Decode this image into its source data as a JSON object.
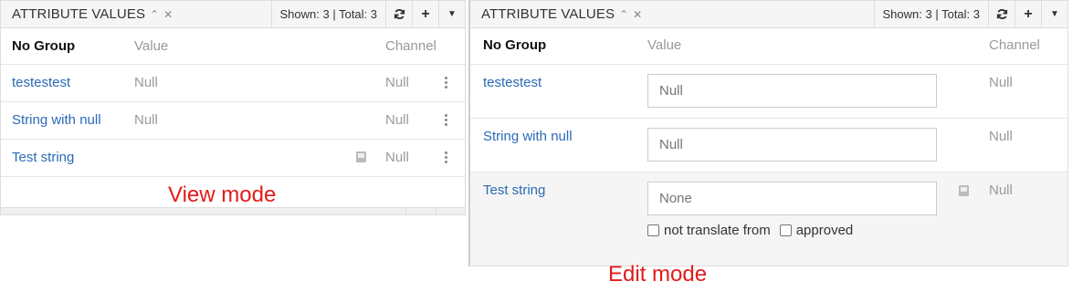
{
  "colors": {
    "link": "#2a6ab5",
    "mode_label": "#e21b1b",
    "muted": "#999999",
    "header_bg": "#f5f5f5"
  },
  "view_panel": {
    "title": "ATTRIBUTE VALUES",
    "header_icons": [
      "chevron-up-icon",
      "close-icon"
    ],
    "count_text": "Shown: 3 | Total: 3",
    "buttons": [
      "refresh-icon",
      "plus-icon",
      "caret-down-icon"
    ],
    "group_label": "No Group",
    "col_value": "Value",
    "col_channel": "Channel",
    "rows": [
      {
        "name": "testestest",
        "value": "Null",
        "channel": "Null"
      },
      {
        "name": "String with null",
        "value": "Null",
        "channel": "Null"
      },
      {
        "name": "Test string",
        "value": "",
        "channel": "Null",
        "icon": "book-icon"
      }
    ]
  },
  "edit_panel": {
    "title": "ATTRIBUTE VALUES",
    "header_icons": [
      "chevron-up-icon",
      "close-icon"
    ],
    "count_text": "Shown: 3 | Total: 3",
    "buttons": [
      "refresh-icon",
      "plus-icon",
      "caret-down-icon"
    ],
    "group_label": "No Group",
    "col_value": "Value",
    "col_channel": "Channel",
    "rows": [
      {
        "name": "testestest",
        "placeholder": "Null",
        "channel": "Null"
      },
      {
        "name": "String with null",
        "placeholder": "Null",
        "channel": "Null"
      },
      {
        "name": "Test string",
        "placeholder": "None",
        "channel": "Null",
        "icon": "book-icon",
        "checkbox_1": "not translate from",
        "checkbox_2": "approved"
      }
    ]
  },
  "labels": {
    "view_mode": "View mode",
    "edit_mode": "Edit mode"
  }
}
